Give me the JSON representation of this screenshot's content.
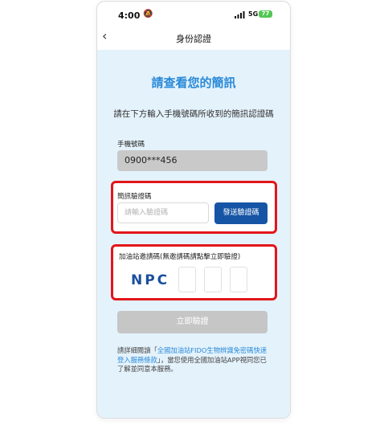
{
  "status_bar": {
    "time": "4:00",
    "network": "5G",
    "battery": "77"
  },
  "nav": {
    "back_icon": "chevron-left-icon",
    "title": "身份認證"
  },
  "main": {
    "headline": "請查看您的簡訊",
    "description": "請在下方輸入手機號碼所收到的簡訊認證碼",
    "phone_label": "手機號碼",
    "phone_value": "0900***456",
    "sms_label": "簡訊驗證碼",
    "sms_placeholder": "請輸入驗證碼",
    "send_button": "發送驗證碼",
    "invite_label": "加油站邀請碼(無邀請碼請點擊立即驗證)",
    "invite_prefix": "NPC",
    "verify_button": "立即驗證",
    "note_prefix": "請詳細閱讀「",
    "note_link": "全國加油站FIDO生物辨識免密碼快速登入服務條款",
    "note_suffix": "」，當您使用全國加油站APP視同您已了解並同意本服務。"
  },
  "colors": {
    "accent": "#2a8ad8",
    "button": "#1655a6",
    "highlight": "#e2161b",
    "background": "#e4f2fb"
  }
}
